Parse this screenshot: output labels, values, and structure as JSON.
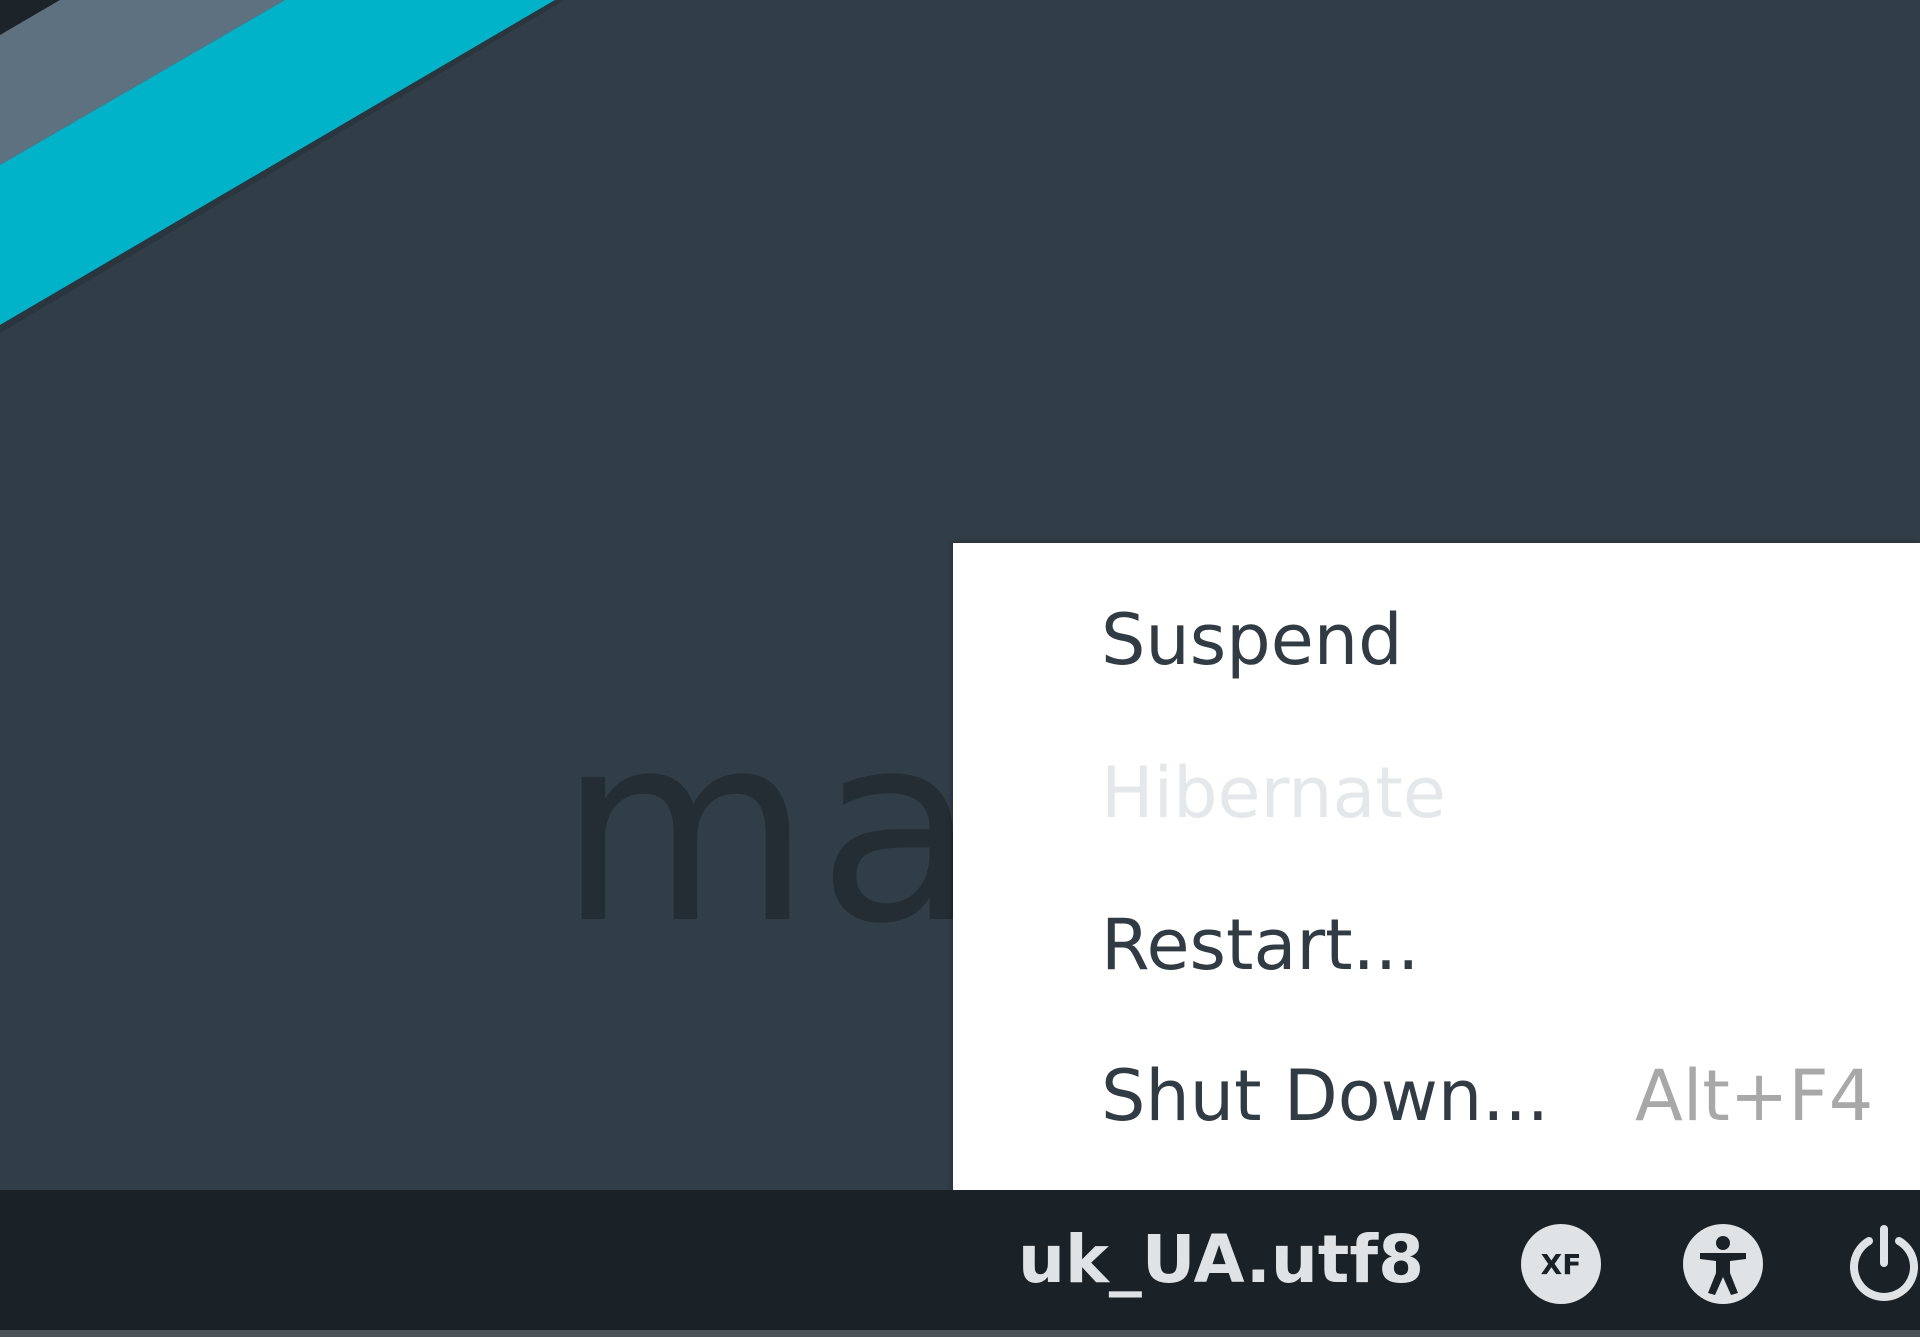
{
  "desktop": {
    "logo_text": "ma"
  },
  "power_menu": {
    "items": [
      {
        "label": "Suspend",
        "enabled": true
      },
      {
        "label": "Hibernate",
        "enabled": false
      },
      {
        "label": "Restart...",
        "enabled": true
      },
      {
        "label": "Shut Down...",
        "accelerator": "Alt+F4",
        "enabled": true
      }
    ]
  },
  "panel": {
    "locale": "uk_UA.utf8",
    "icons": [
      "xfce-icon",
      "accessibility-icon",
      "power-icon"
    ]
  },
  "colors": {
    "background": "#313e47",
    "accent_cyan": "#00b3c8",
    "stripe_gray": "#5e7180",
    "panel": "#1b2227",
    "menu_bg": "#ffffff",
    "menu_text": "#303b43",
    "disabled_text": "#e4e8ea",
    "accel_text": "#a8a8a8",
    "panel_text": "#dfe3e6"
  }
}
